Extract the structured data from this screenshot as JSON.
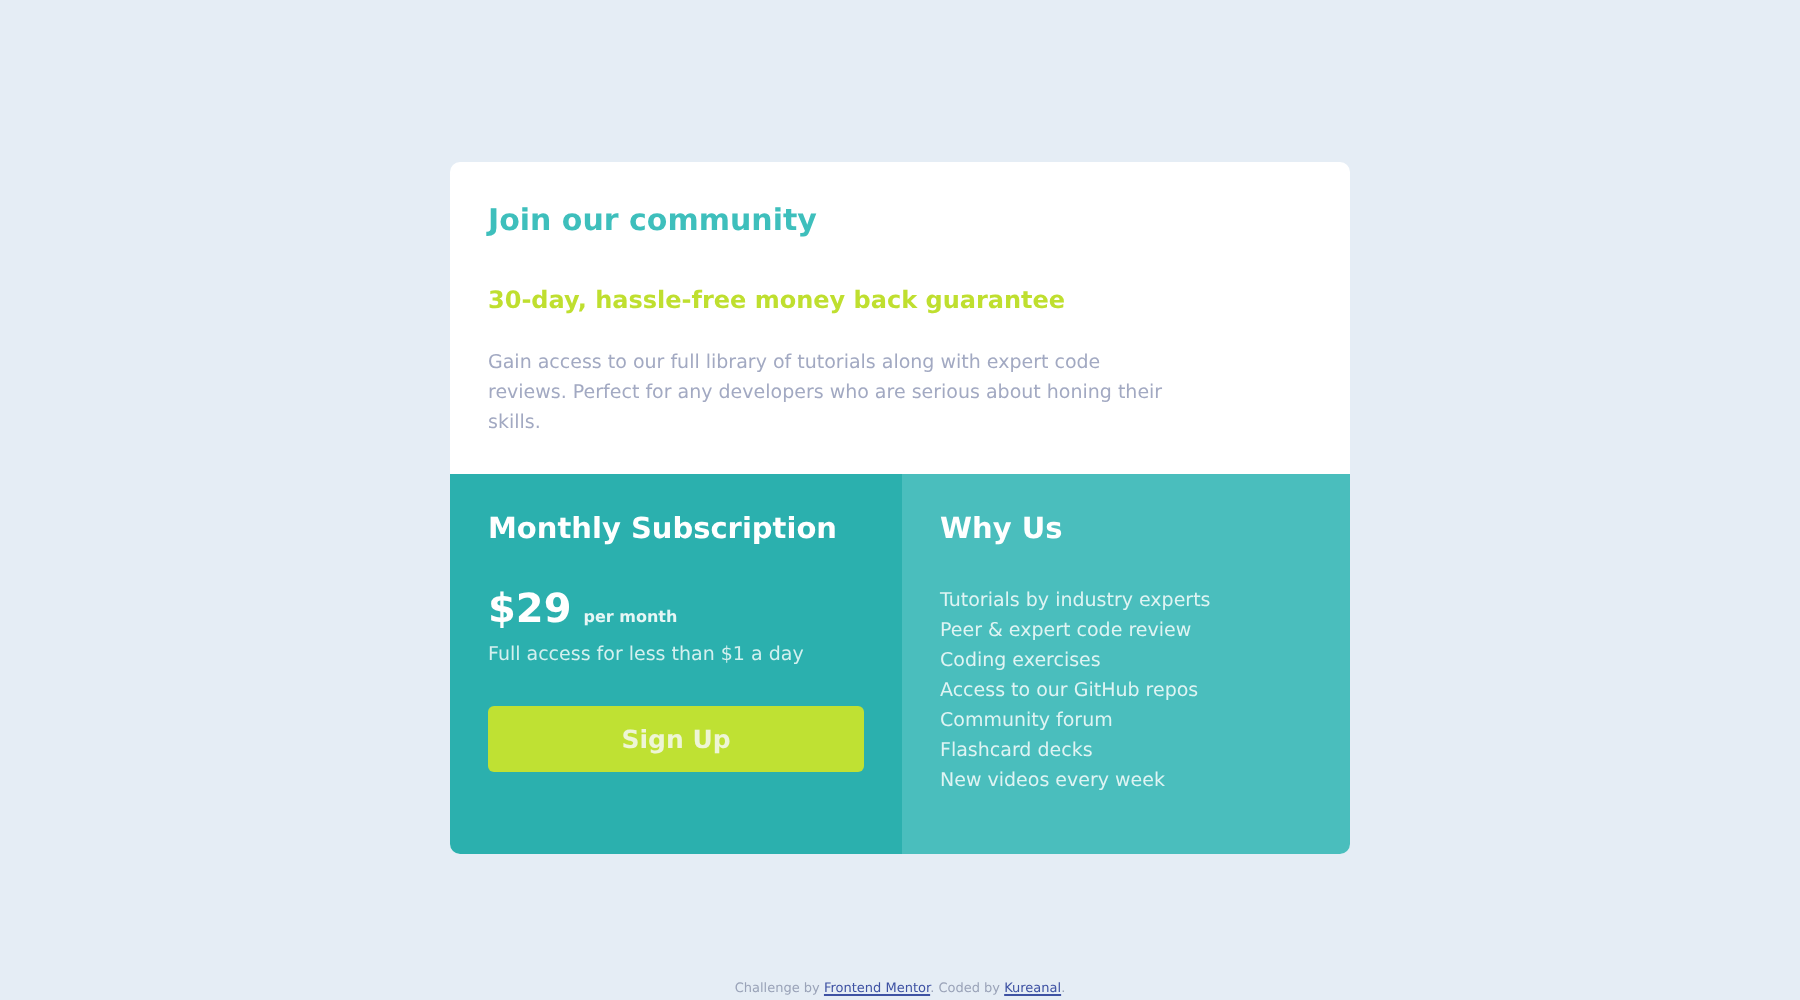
{
  "community": {
    "title": "Join our community",
    "guarantee": "30-day, hassle-free money back guarantee",
    "description": "Gain access to our full library of tutorials along with expert code reviews. Perfect for any developers who are serious about honing their skills."
  },
  "subscription": {
    "title": "Monthly Subscription",
    "price": "$29",
    "period": "per month",
    "note": "Full access for less than $1 a day",
    "button": "Sign Up"
  },
  "why_us": {
    "title": "Why Us",
    "items": [
      "Tutorials by industry experts",
      "Peer & expert code review",
      "Coding exercises",
      "Access to our GitHub repos",
      "Community forum",
      "Flashcard decks",
      "New videos every week"
    ]
  },
  "attribution": {
    "parts": [
      {
        "kind": "text",
        "text": "Challenge by "
      },
      {
        "kind": "link",
        "text": "Frontend Mentor"
      },
      {
        "kind": "text",
        "text": ". Coded by "
      },
      {
        "kind": "link",
        "text": "Kureanal"
      },
      {
        "kind": "text",
        "text": "."
      }
    ]
  }
}
